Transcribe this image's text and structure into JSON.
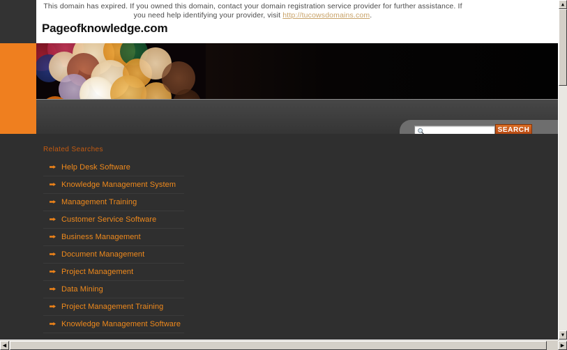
{
  "notice": {
    "text_before_link": "This domain has expired. If you owned this domain, contact your domain registration service provider for further assistance. If you need help identifying your provider, visit ",
    "link_label": "http://tucowsdomains.com",
    "text_after_link": "."
  },
  "site": {
    "title": "Pageofknowledge.com"
  },
  "search": {
    "value": "",
    "placeholder": "",
    "button_label": "SEARCH",
    "icon": "search-icon"
  },
  "main": {
    "related_heading": "Related Searches",
    "links": [
      {
        "label": "Help Desk Software"
      },
      {
        "label": "Knowledge Management System"
      },
      {
        "label": "Management Training"
      },
      {
        "label": "Customer Service Software"
      },
      {
        "label": "Business Management"
      },
      {
        "label": "Document Management"
      },
      {
        "label": "Project Management"
      },
      {
        "label": "Data Mining"
      },
      {
        "label": "Project Management Training"
      },
      {
        "label": "Knowledge Management Software"
      }
    ]
  },
  "scrollbars": {
    "up_arrow": "▲",
    "down_arrow": "▼",
    "left_arrow": "◀",
    "right_arrow": "▶"
  },
  "colors": {
    "accent_orange": "#ef7f1f",
    "link_orange": "#f08a1c",
    "heading_orange": "#c45b10",
    "button_orange": "#c3551a",
    "page_dark": "#2f2f2f",
    "nav_gray": "#3d3d3d",
    "notice_link": "#c8a268"
  }
}
